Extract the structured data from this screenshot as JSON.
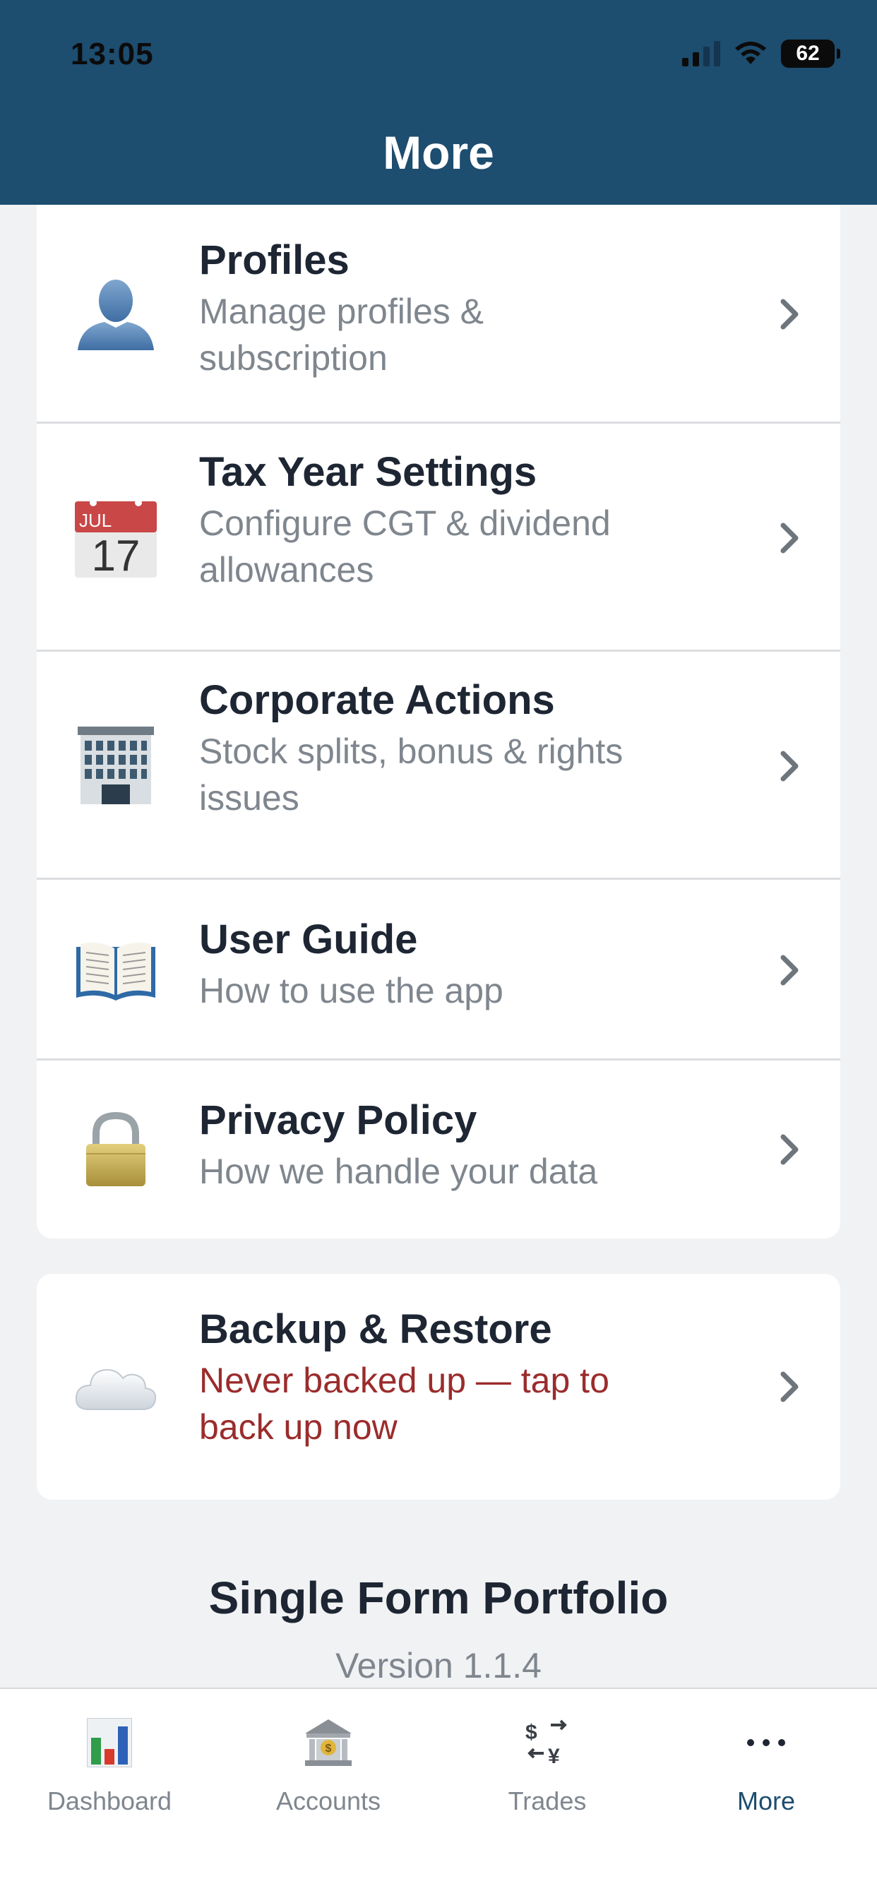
{
  "status_bar": {
    "time": "13:05",
    "battery": "62"
  },
  "header": {
    "title": "More"
  },
  "menu": [
    {
      "title": "Profiles",
      "subtitle_lines": [
        "Manage profiles &",
        "subscription"
      ],
      "icon": "person-silhouette-icon"
    },
    {
      "title": "Tax Year Settings",
      "subtitle_lines": [
        "Configure CGT & dividend",
        "allowances"
      ],
      "icon": "calendar-icon",
      "calendar": {
        "month": "JUL",
        "day": "17"
      }
    },
    {
      "title": "Corporate Actions",
      "subtitle_lines": [
        "Stock splits, bonus & rights",
        "issues"
      ],
      "icon": "office-building-icon"
    },
    {
      "title": "User Guide",
      "subtitle_lines": [
        "How to use the app"
      ],
      "icon": "open-book-icon"
    },
    {
      "title": "Privacy Policy",
      "subtitle_lines": [
        "How we handle your data"
      ],
      "icon": "padlock-icon"
    }
  ],
  "backup": {
    "title": "Backup & Restore",
    "subtitle_lines": [
      "Never backed up — tap to",
      "back up now"
    ],
    "icon": "cloud-icon",
    "warning_color": "#9b2c2c"
  },
  "app_info": {
    "name": "Single Form Portfolio",
    "version": "Version 1.1.4"
  },
  "tabs": [
    {
      "label": "Dashboard",
      "icon": "bar-chart-icon",
      "active": false
    },
    {
      "label": "Accounts",
      "icon": "bank-icon",
      "active": false
    },
    {
      "label": "Trades",
      "icon": "currency-exchange-icon",
      "active": false
    },
    {
      "label": "More",
      "icon": "ellipsis-icon",
      "active": true
    }
  ],
  "colors": {
    "header": "#1d4d6f",
    "background": "#f1f2f4",
    "active_tab": "#1d4d6f"
  }
}
